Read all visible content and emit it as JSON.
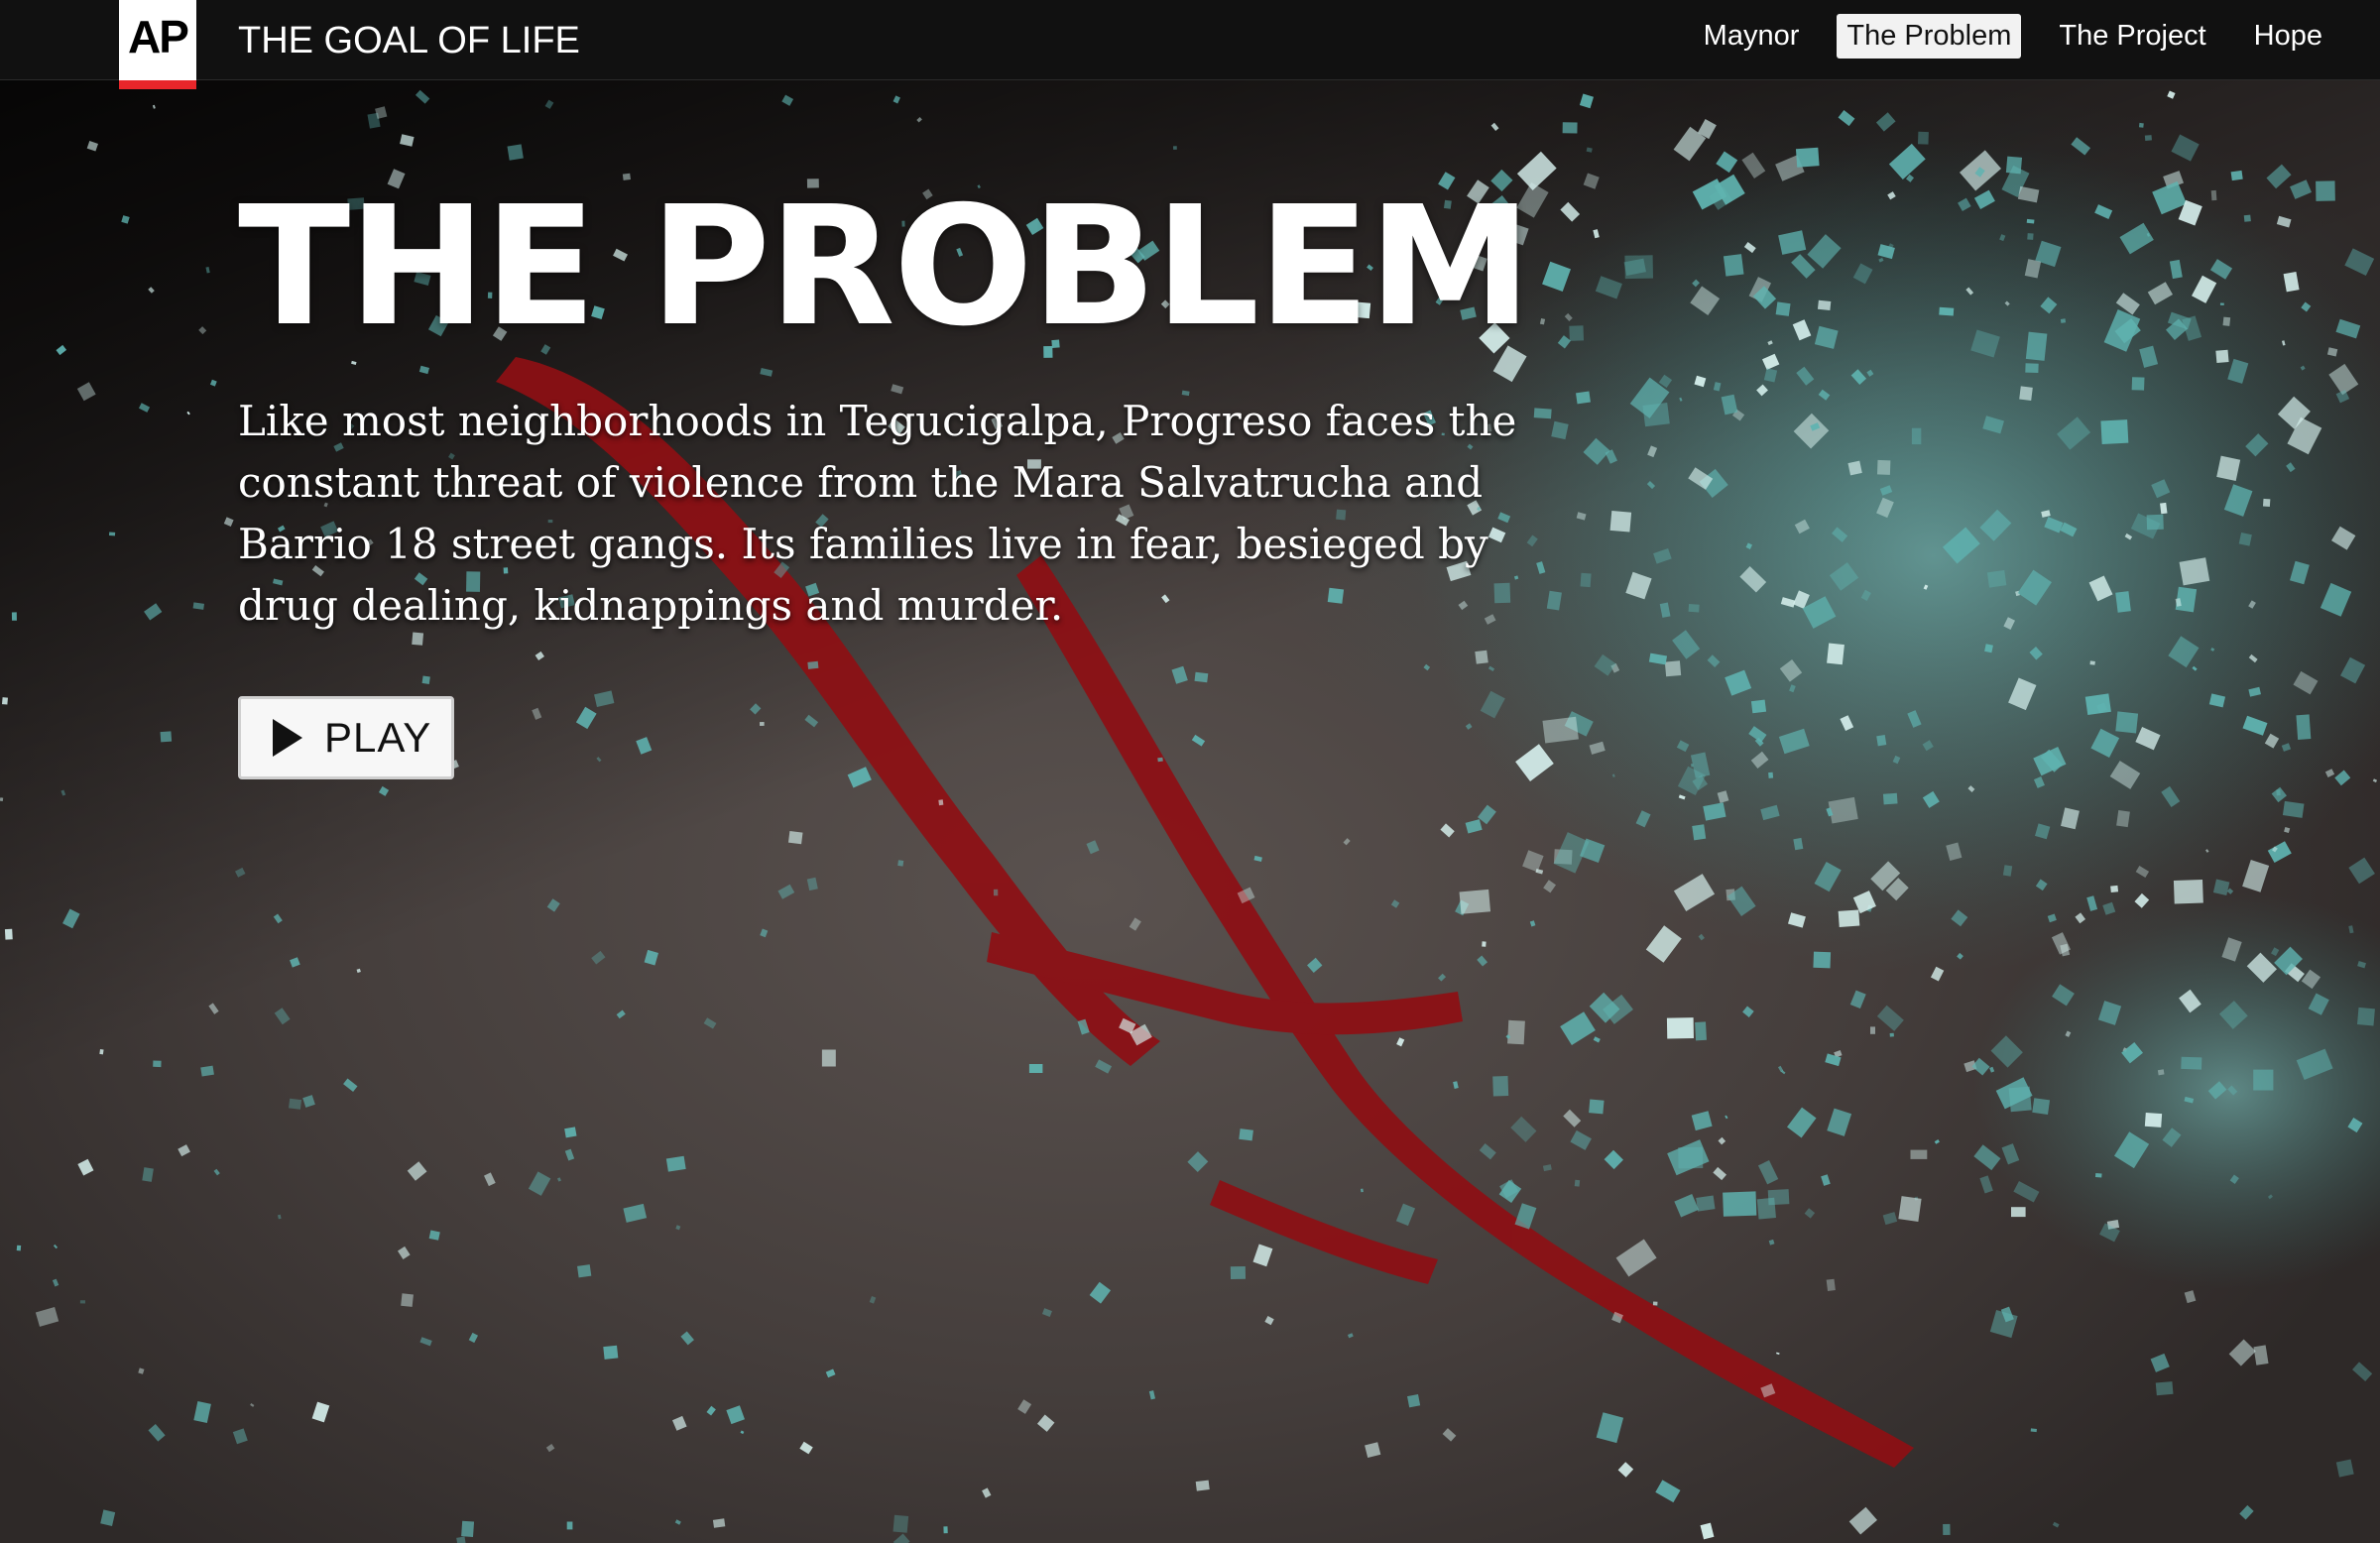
{
  "header": {
    "logo_text": "AP",
    "site_title": "THE GOAL OF LIFE",
    "nav": [
      {
        "label": "Maynor",
        "active": false
      },
      {
        "label": "The Problem",
        "active": true
      },
      {
        "label": "The Project",
        "active": false
      },
      {
        "label": "Hope",
        "active": false
      }
    ]
  },
  "hero": {
    "title": "THE PROBLEM",
    "description": "Like most neighborhoods in Tegucigalpa, Progreso faces the constant threat of violence from the Mara Salvatrucha and Barrio 18 street gangs. Its families live in fear, besieged by drug dealing, kidnappings and murder.",
    "play_label": "PLAY"
  },
  "colors": {
    "topbar": "#111111",
    "brand_red": "#e8262a",
    "glass": "#5fb3b0",
    "blood": "#8e0f14"
  },
  "icons": {
    "play": "play-icon"
  }
}
